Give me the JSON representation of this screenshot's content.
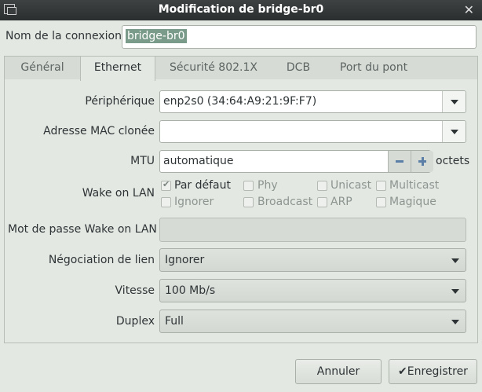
{
  "window": {
    "title": "Modification de bridge-br0",
    "close_icon": "✕"
  },
  "connection_name": {
    "label": "Nom de la connexion",
    "value": "bridge-br0"
  },
  "tabs": [
    {
      "label": "Général"
    },
    {
      "label": "Ethernet"
    },
    {
      "label": "Sécurité 802.1X"
    },
    {
      "label": "DCB"
    },
    {
      "label": "Port du pont"
    }
  ],
  "ethernet": {
    "device": {
      "label": "Périphérique",
      "value": "enp2s0 (34:64:A9:21:9F:F7)"
    },
    "cloned_mac": {
      "label": "Adresse MAC clonée",
      "value": ""
    },
    "mtu": {
      "label": "MTU",
      "value": "automatique",
      "unit": "octets"
    },
    "wake_on_lan": {
      "label": "Wake on LAN",
      "options": [
        {
          "label": "Par défaut",
          "checked": true
        },
        {
          "label": "Phy",
          "checked": false
        },
        {
          "label": "Unicast",
          "checked": false
        },
        {
          "label": "Multicast",
          "checked": false
        },
        {
          "label": "Ignorer",
          "checked": false
        },
        {
          "label": "Broadcast",
          "checked": false
        },
        {
          "label": "ARP",
          "checked": false
        },
        {
          "label": "Magique",
          "checked": false
        }
      ]
    },
    "wol_password": {
      "label": "Mot de passe Wake on LAN",
      "value": ""
    },
    "link_negotiation": {
      "label": "Négociation de lien",
      "value": "Ignorer"
    },
    "speed": {
      "label": "Vitesse",
      "value": "100 Mb/s"
    },
    "duplex": {
      "label": "Duplex",
      "value": "Full"
    }
  },
  "buttons": {
    "cancel": "Annuler",
    "save": "Enregistrer",
    "save_icon": "✔"
  }
}
